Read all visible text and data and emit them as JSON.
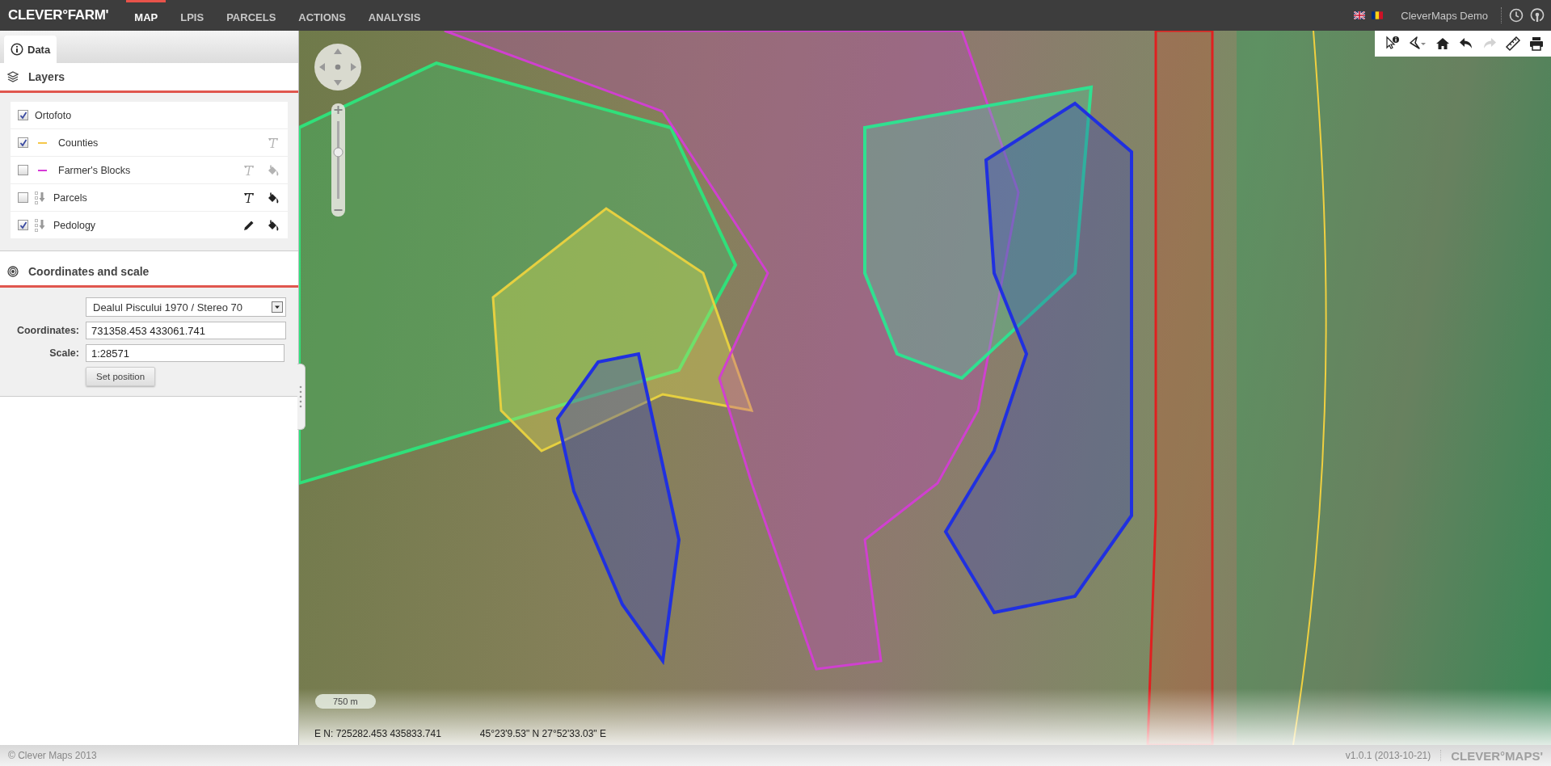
{
  "brand": "CLEVER°FARM'",
  "nav": [
    {
      "label": "MAP",
      "selected": true
    },
    {
      "label": "LPIS",
      "selected": false
    },
    {
      "label": "PARCELS",
      "selected": false
    },
    {
      "label": "ACTIONS",
      "selected": false
    },
    {
      "label": "ANALYSIS",
      "selected": false
    }
  ],
  "user": "CleverMaps Demo",
  "panel_tab": {
    "label": "Data",
    "selected": true
  },
  "layers_title": "Layers",
  "layers": [
    {
      "name": "Ortofoto",
      "checked": true,
      "kind": "plain"
    },
    {
      "name": "Counties",
      "checked": true,
      "kind": "line",
      "color": "#f5c84a",
      "tools": [
        {
          "kind": "label",
          "active": false
        }
      ]
    },
    {
      "name": "Farmer's Blocks",
      "checked": false,
      "kind": "line",
      "color": "#d63ad6",
      "tools": [
        {
          "kind": "label",
          "active": false
        },
        {
          "kind": "fill",
          "active": false
        }
      ]
    },
    {
      "name": "Parcels",
      "checked": false,
      "kind": "tree",
      "tools": [
        {
          "kind": "label",
          "active": true
        },
        {
          "kind": "fill",
          "active": true
        }
      ]
    },
    {
      "name": "Pedology",
      "checked": true,
      "kind": "tree",
      "tools": [
        {
          "kind": "edit",
          "active": true
        },
        {
          "kind": "fill",
          "active": true
        }
      ]
    }
  ],
  "coords_title": "Coordinates and scale",
  "coords_form": {
    "coordinates_label": "Coordinates:",
    "system": "Dealul Piscului 1970 / Stereo 70",
    "coordinates_value": "731358.453 433061.741",
    "scale_label": "Scale:",
    "scale_value": "1:28571",
    "button": "Set position"
  },
  "map_toolbar": [
    {
      "kind": "info",
      "disabled": false
    },
    {
      "kind": "select",
      "disabled": false
    },
    {
      "kind": "home",
      "disabled": false
    },
    {
      "kind": "undo",
      "disabled": false
    },
    {
      "kind": "redo",
      "disabled": true
    },
    {
      "kind": "measure",
      "disabled": false
    },
    {
      "kind": "print",
      "disabled": false
    }
  ],
  "zoom_slider": {
    "level": 0.6
  },
  "scale_bar": "750 m",
  "map_coords": {
    "projected": "E N: 725282.453 435833.741",
    "geographic": "45°23'9.53\" N 27°52'33.03\" E"
  },
  "footer": {
    "copyright": "© Clever Maps 2013",
    "version": "v1.0.1 (2013-10-21)",
    "logo": "CLEVER°MAPS'"
  }
}
